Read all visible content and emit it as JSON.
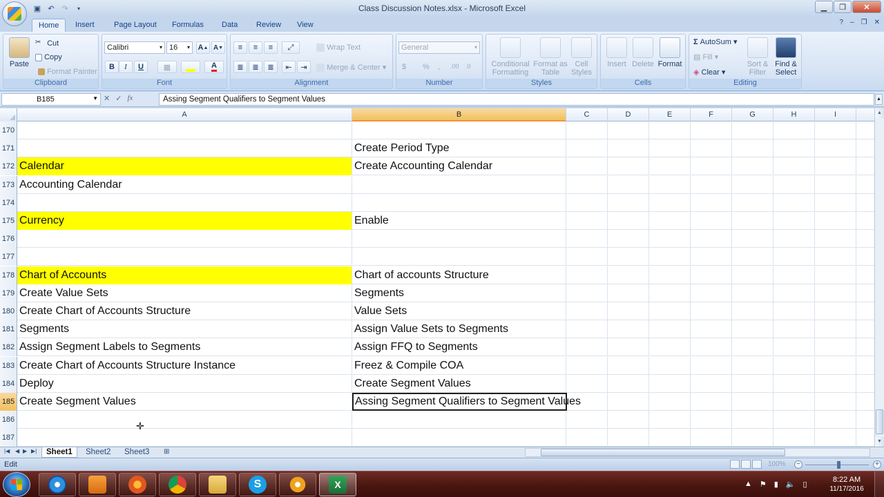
{
  "window": {
    "title": "Class Discussion Notes.xlsx - Microsoft Excel",
    "controls": [
      "minimize",
      "restore",
      "close"
    ]
  },
  "quick_access": [
    "save-icon",
    "undo-icon",
    "redo-icon"
  ],
  "ribbon": {
    "tabs": [
      "Home",
      "Insert",
      "Page Layout",
      "Formulas",
      "Data",
      "Review",
      "View"
    ],
    "active_tab": "Home",
    "clipboard": {
      "label": "Clipboard",
      "paste": "Paste",
      "cut": "Cut",
      "copy": "Copy",
      "format_painter": "Format Painter"
    },
    "font": {
      "label": "Font",
      "name": "Calibri",
      "size": "16",
      "bold": "B",
      "italic": "I",
      "underline": "U"
    },
    "alignment": {
      "label": "Alignment",
      "wrap_text": "Wrap Text",
      "merge_center": "Merge & Center"
    },
    "number": {
      "label": "Number",
      "format": "General",
      "currency": "$",
      "percent": "%"
    },
    "styles": {
      "label": "Styles",
      "conditional": "Conditional Formatting",
      "format_table": "Format as Table",
      "cell_styles": "Cell Styles"
    },
    "cells": {
      "label": "Cells",
      "insert": "Insert",
      "delete": "Delete",
      "format": "Format"
    },
    "editing": {
      "label": "Editing",
      "autosum": "AutoSum",
      "fill": "Fill",
      "clear": "Clear",
      "sort_filter": "Sort & Filter",
      "find_select": "Find & Select"
    }
  },
  "formula_bar": {
    "name_box": "B185",
    "fx": "fx",
    "content": "Assing Segment Qualifiers to Segment Values"
  },
  "grid": {
    "columns": [
      "A",
      "B",
      "C",
      "D",
      "E",
      "F",
      "G",
      "H",
      "I"
    ],
    "selected_column": "B",
    "selected_row": "185",
    "rows": [
      {
        "num": "170",
        "a": "",
        "b": "",
        "a_highlight": false
      },
      {
        "num": "171",
        "a": "",
        "b": "Create Period Type",
        "a_highlight": false
      },
      {
        "num": "172",
        "a": "Calendar",
        "b": "Create Accounting Calendar",
        "a_highlight": true
      },
      {
        "num": "173",
        "a": "Accounting Calendar",
        "b": "",
        "a_highlight": false
      },
      {
        "num": "174",
        "a": "",
        "b": "",
        "a_highlight": false
      },
      {
        "num": "175",
        "a": "Currency",
        "b": "Enable",
        "a_highlight": true
      },
      {
        "num": "176",
        "a": "",
        "b": "",
        "a_highlight": false
      },
      {
        "num": "177",
        "a": "",
        "b": "",
        "a_highlight": false
      },
      {
        "num": "178",
        "a": "Chart of Accounts",
        "b": "Chart of accounts Structure",
        "a_highlight": true
      },
      {
        "num": "179",
        "a": "Create Value Sets",
        "b": "Segments",
        "a_highlight": false
      },
      {
        "num": "180",
        "a": "Create Chart of Accounts Structure",
        "b": "Value Sets",
        "a_highlight": false
      },
      {
        "num": "181",
        "a": "Segments",
        "b": "Assign Value Sets to Segments",
        "a_highlight": false
      },
      {
        "num": "182",
        "a": "Assign Segment Labels to Segments",
        "b": "Assign FFQ to Segments",
        "a_highlight": false
      },
      {
        "num": "183",
        "a": "Create Chart of Accounts Structure Instance",
        "b": "Freez & Compile COA",
        "a_highlight": false
      },
      {
        "num": "184",
        "a": "Deploy",
        "b": "Create Segment Values",
        "a_highlight": false
      },
      {
        "num": "185",
        "a": "Create Segment Values",
        "b": "Assing Segment Qualifiers to Segment Values",
        "a_highlight": false
      },
      {
        "num": "186",
        "a": "",
        "b": "",
        "a_highlight": false
      },
      {
        "num": "187",
        "a": "",
        "b": "",
        "a_highlight": false
      }
    ],
    "highlight_color": "#ffff00"
  },
  "sheets": {
    "tabs": [
      "Sheet1",
      "Sheet2",
      "Sheet3"
    ],
    "active": "Sheet1"
  },
  "status": {
    "mode": "Edit",
    "zoom": "100%"
  },
  "taskbar": {
    "apps": [
      "start-button",
      "internet-explorer-icon",
      "media-player-icon",
      "firefox-icon",
      "chrome-icon",
      "file-explorer-icon",
      "skype-icon",
      "app-icon",
      "excel-icon"
    ],
    "clock_time": "8:22 AM",
    "clock_date": "11/17/2016"
  }
}
